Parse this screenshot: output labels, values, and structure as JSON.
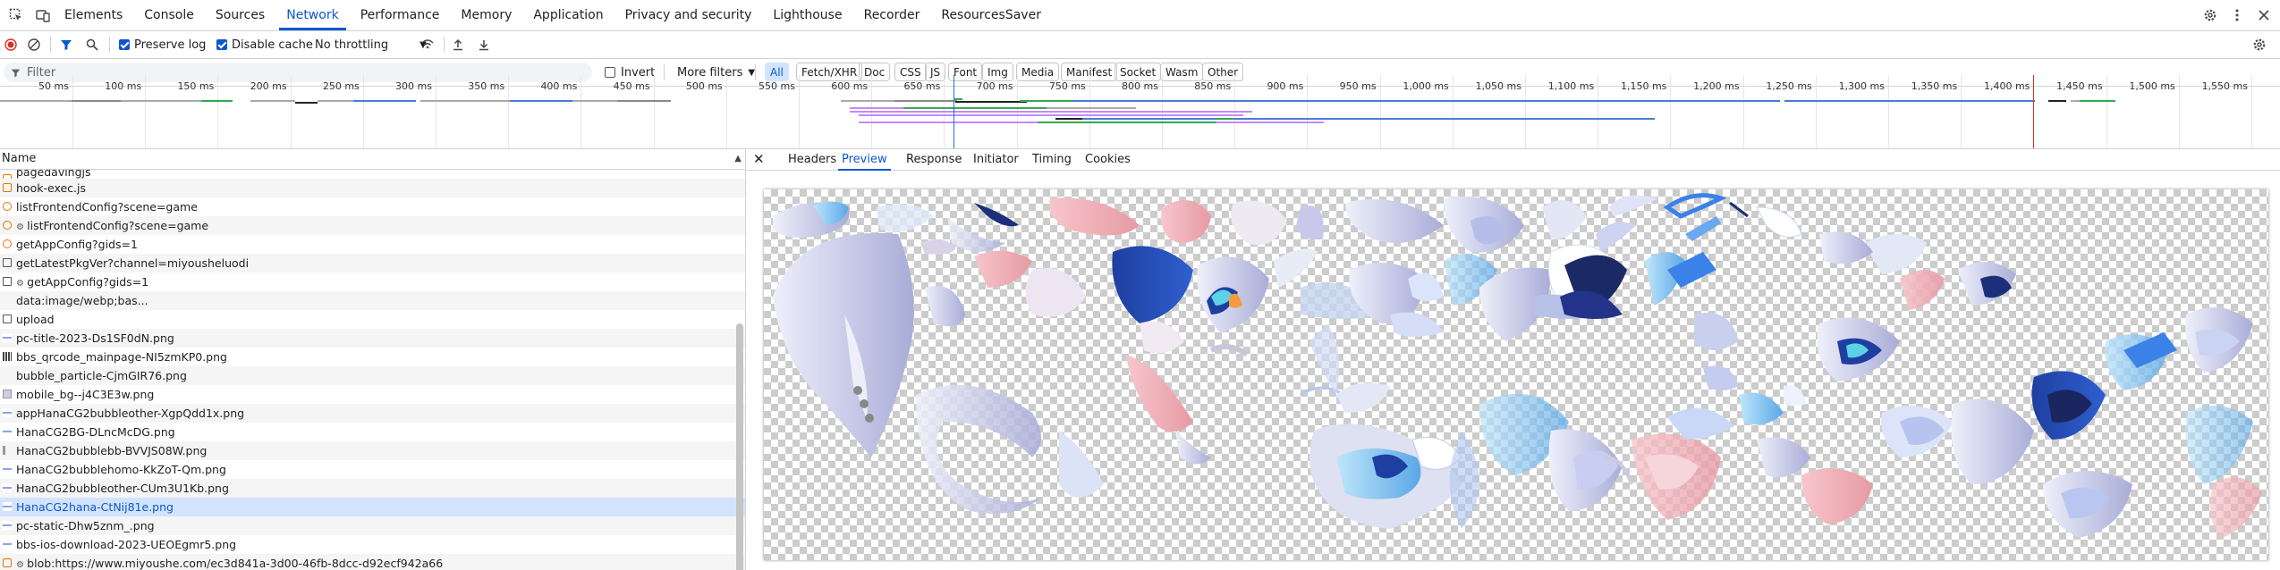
{
  "devtools": {
    "tabs": [
      "Elements",
      "Console",
      "Sources",
      "Network",
      "Performance",
      "Memory",
      "Application",
      "Privacy and security",
      "Lighthouse",
      "Recorder",
      "ResourcesSaver"
    ],
    "active_tab": "Network"
  },
  "toolbar": {
    "preserve_log": "Preserve log",
    "disable_cache": "Disable cache",
    "throttling": "No throttling"
  },
  "filter": {
    "placeholder": "Filter",
    "invert": "Invert",
    "more_filters": "More filters",
    "types": [
      "All",
      "Fetch/XHR",
      "Doc",
      "CSS",
      "JS",
      "Font",
      "Img",
      "Media",
      "Manifest",
      "Socket",
      "Wasm",
      "Other"
    ]
  },
  "timeline": {
    "ticks": [
      "50 ms",
      "100 ms",
      "150 ms",
      "200 ms",
      "250 ms",
      "300 ms",
      "350 ms",
      "400 ms",
      "450 ms",
      "500 ms",
      "550 ms",
      "600 ms",
      "650 ms",
      "700 ms",
      "750 ms",
      "800 ms",
      "850 ms",
      "900 ms",
      "950 ms",
      "1,000 ms",
      "1,050 ms",
      "1,100 ms",
      "1,150 ms",
      "1,200 ms",
      "1,250 ms",
      "1,300 ms",
      "1,350 ms",
      "1,400 ms",
      "1,450 ms",
      "1,500 ms",
      "1,550 ms"
    ]
  },
  "requests": {
    "header": "Name",
    "items": [
      {
        "name": "pagedavingjs",
        "icon": "script",
        "cut": true
      },
      {
        "name": "hook-exec.js",
        "icon": "script"
      },
      {
        "name": "listFrontendConfig?scene=game",
        "icon": "xhr"
      },
      {
        "name": "listFrontendConfig?scene=game",
        "icon": "xhr-dot"
      },
      {
        "name": "getAppConfig?gids=1",
        "icon": "xhr"
      },
      {
        "name": "getLatestPkgVer?channel=miyousheluodi",
        "icon": "doc"
      },
      {
        "name": "getAppConfig?gids=1",
        "icon": "doc-dot"
      },
      {
        "name": "data:image/webp;bas...",
        "icon": "none"
      },
      {
        "name": "upload",
        "icon": "doc"
      },
      {
        "name": "pc-title-2023-Ds1SF0dN.png",
        "icon": "img"
      },
      {
        "name": "bbs_qrcode_mainpage-NI5zmKP0.png",
        "icon": "img-qr"
      },
      {
        "name": "bubble_particle-CjmGIR76.png",
        "icon": "none"
      },
      {
        "name": "mobile_bg--j4C3E3w.png",
        "icon": "img-mobile"
      },
      {
        "name": "appHanaCG2bubbleother-XgpQdd1x.png",
        "icon": "img"
      },
      {
        "name": "HanaCG2BG-DLncMcDG.png",
        "icon": "img"
      },
      {
        "name": "HanaCG2bubblebb-BVVJS08W.png",
        "icon": "img-tiny"
      },
      {
        "name": "HanaCG2bubblehomo-KkZoT-Qm.png",
        "icon": "img"
      },
      {
        "name": "HanaCG2bubbleother-CUm3U1Kb.png",
        "icon": "img"
      },
      {
        "name": "HanaCG2hana-CtNij81e.png",
        "icon": "img",
        "selected": true
      },
      {
        "name": "pc-static-Dhw5znm_.png",
        "icon": "img"
      },
      {
        "name": "bbs-ios-download-2023-UEOEgmr5.png",
        "icon": "img"
      },
      {
        "name": "blob:https://www.miyoushe.com/ec3d841a-3d00-46fb-8dcc-d92ecf942a66",
        "icon": "blob"
      }
    ]
  },
  "detail": {
    "tabs": [
      "Headers",
      "Preview",
      "Response",
      "Initiator",
      "Timing",
      "Cookies"
    ],
    "active_tab": "Preview"
  },
  "colors": {
    "accent": "#0b57d0",
    "selected_row": "#d3e3fd",
    "red_marker": "#d93025",
    "blue_bar": "#4a7bd8",
    "purple_bar": "#c58af9",
    "green_bar": "#34a853"
  }
}
